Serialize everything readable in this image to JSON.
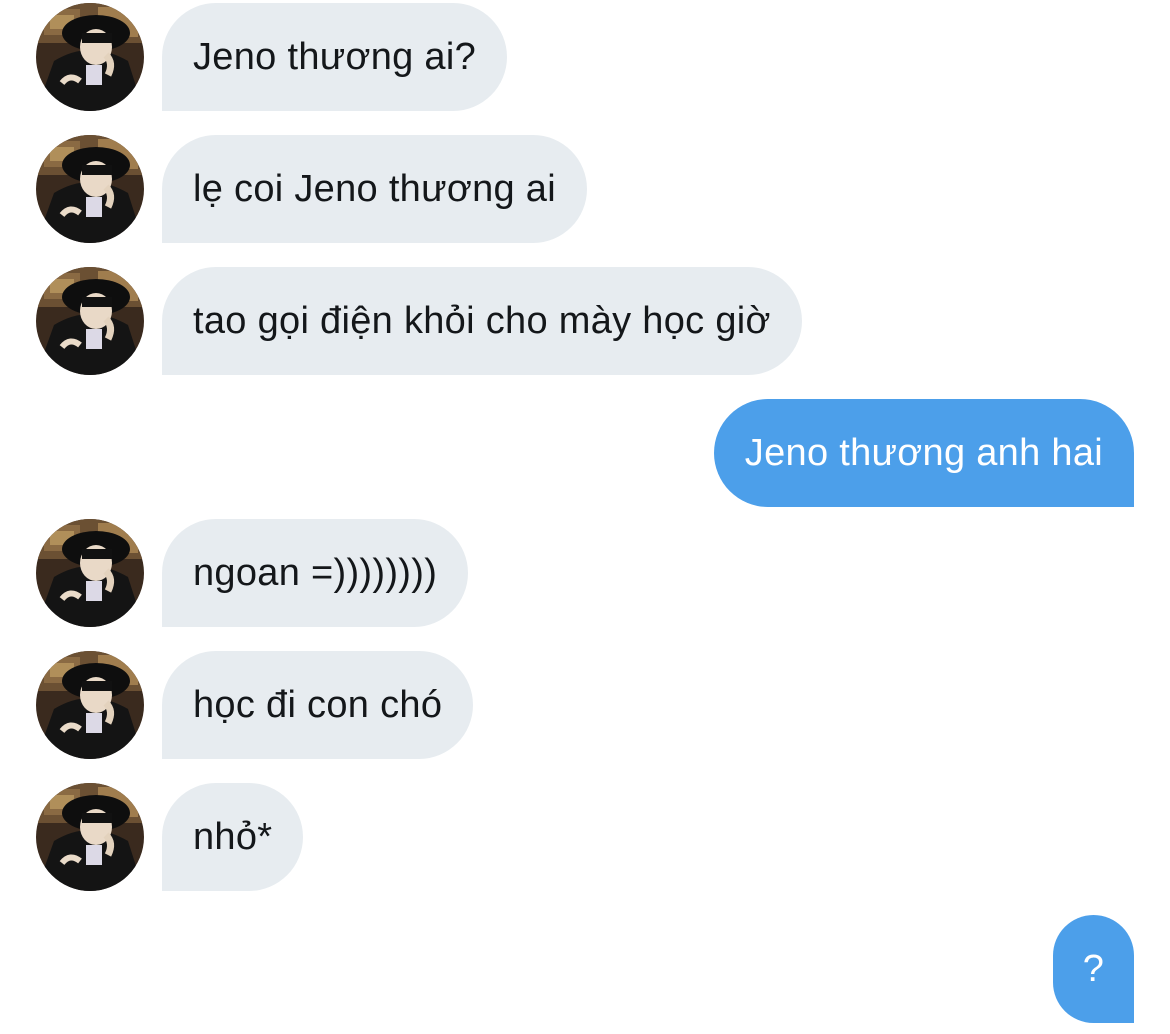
{
  "messages": [
    {
      "sender": "them",
      "text": "Jeno thương ai?"
    },
    {
      "sender": "them",
      "text": "lẹ coi Jeno thương ai"
    },
    {
      "sender": "them",
      "text": "tao gọi điện khỏi cho mày học giờ"
    },
    {
      "sender": "me",
      "text": "Jeno thương anh hai"
    },
    {
      "sender": "them",
      "text": "ngoan =))))))))"
    },
    {
      "sender": "them",
      "text": "học đi con chó"
    },
    {
      "sender": "them",
      "text": "nhỏ*"
    },
    {
      "sender": "me",
      "text": "?"
    }
  ],
  "colors": {
    "incoming_bubble": "#e7ecf0",
    "incoming_text": "#14171a",
    "outgoing_bubble": "#4c9fea",
    "outgoing_text": "#ffffff",
    "background": "#ffffff"
  },
  "icons": {
    "avatar": "contact-avatar-photo"
  }
}
